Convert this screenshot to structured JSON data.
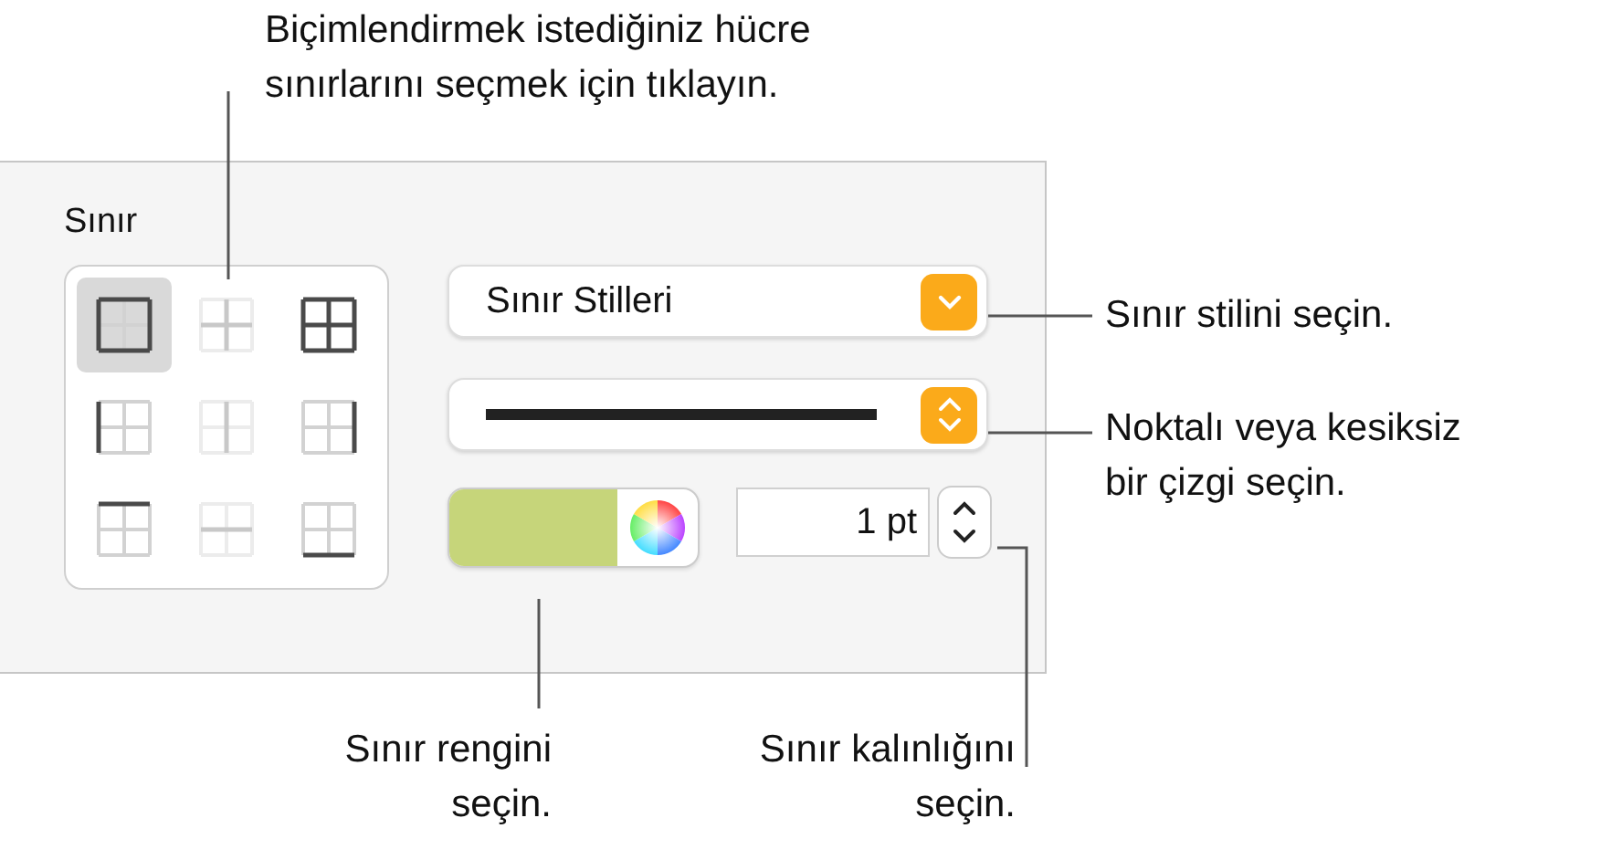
{
  "callouts": [
    {
      "kind": "top",
      "text": "Biçimlendirmek istediğiniz hücre\nsınırlarını seçmek için tıklayın."
    },
    {
      "kind": "style",
      "text": "Sınır stilini seçin."
    },
    {
      "kind": "line",
      "text": "Noktalı veya kesiksiz\nbir çizgi seçin."
    },
    {
      "kind": "color",
      "text": "Sınır rengini\nseçin."
    },
    {
      "kind": "width",
      "text": "Sınır kalınlığını\nseçin."
    }
  ],
  "panel": {
    "title": "Sınır",
    "border_buttons": [
      {
        "kind": "outer",
        "selected": true
      },
      {
        "kind": "inner",
        "selected": false
      },
      {
        "kind": "all",
        "selected": false
      },
      {
        "kind": "left",
        "selected": false
      },
      {
        "kind": "vertical",
        "selected": false
      },
      {
        "kind": "right",
        "selected": false
      },
      {
        "kind": "top",
        "selected": false
      },
      {
        "kind": "horizontal",
        "selected": false
      },
      {
        "kind": "bottom",
        "selected": false
      }
    ],
    "style_popup": {
      "value": "Sınır Stilleri"
    },
    "color_well": {
      "color": "#c6d57a"
    },
    "width_field": {
      "value": "1 pt"
    }
  }
}
